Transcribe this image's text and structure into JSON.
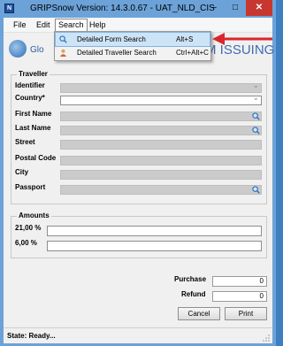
{
  "window": {
    "title": "GRIPSnow Version: 14.3.0.67 - UAT_NLD_CIS",
    "minimize": "–",
    "maximize": "□",
    "close": "✕"
  },
  "menu": {
    "file": "File",
    "edit": "Edit",
    "search": "Search",
    "help": "Help"
  },
  "search_menu": {
    "items": [
      {
        "label": "Detailed Form Search",
        "shortcut": "Alt+S",
        "icon": "magnifier-icon"
      },
      {
        "label": "Detailed Traveller Search",
        "shortcut": "Ctrl+Alt+C",
        "icon": "person-icon"
      }
    ]
  },
  "banner": {
    "logo_text": "Glo",
    "title": "M ISSUING"
  },
  "traveller": {
    "group_title": "Traveller",
    "identifier_label": "Identifier",
    "country_label": "Country*",
    "first_name_label": "First Name",
    "last_name_label": "Last Name",
    "street_label": "Street",
    "postal_code_label": "Postal Code",
    "city_label": "City",
    "passport_label": "Passport"
  },
  "amounts": {
    "group_title": "Amounts",
    "rate1": "21,00 %",
    "rate2": "6,00 %"
  },
  "totals": {
    "purchase_label": "Purchase",
    "purchase_value": "0",
    "refund_label": "Refund",
    "refund_value": "0"
  },
  "buttons": {
    "cancel": "Cancel",
    "print": "Print"
  },
  "status": {
    "text": "State:  Ready..."
  },
  "colors": {
    "title_bar": "#6ca2d8",
    "close_button": "#c7372f",
    "arrow": "#d9262c",
    "menu_highlight": "#cde4f7"
  }
}
